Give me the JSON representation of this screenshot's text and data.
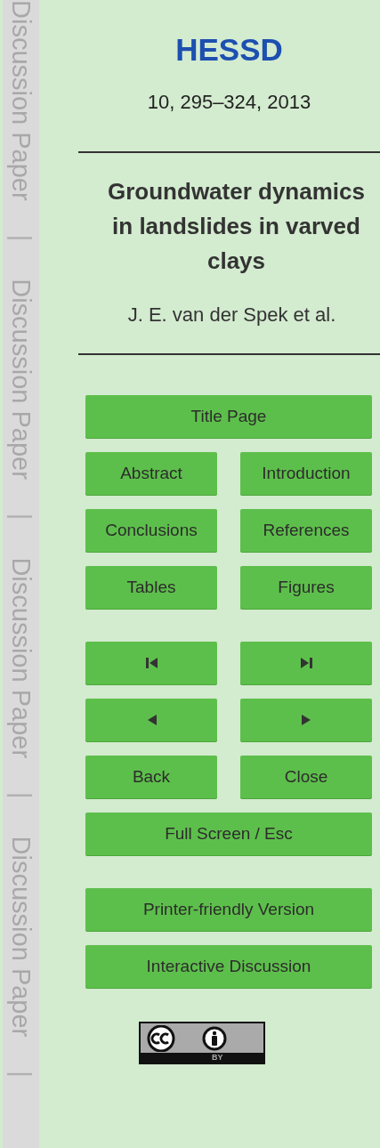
{
  "margin_strip": [
    {
      "kind": "label",
      "text": "Discussion Paper"
    },
    {
      "kind": "separator",
      "text": "|"
    },
    {
      "kind": "label",
      "text": "Discussion Paper"
    },
    {
      "kind": "separator",
      "text": "|"
    },
    {
      "kind": "label",
      "text": "Discussion Paper"
    },
    {
      "kind": "separator",
      "text": "|"
    },
    {
      "kind": "label",
      "text": "Discussion Paper"
    },
    {
      "kind": "separator",
      "text": "|"
    }
  ],
  "journal": "HESSD",
  "citation": "10, 295–324, 2013",
  "title": "Groundwater dynamics in landslides in varved clays",
  "authors": "J. E. van der Spek et al.",
  "button_groups": [
    [
      [
        {
          "kind": "text",
          "label": "Title Page"
        }
      ],
      [
        {
          "kind": "text",
          "label": "Abstract"
        },
        {
          "kind": "text",
          "label": "Introduction"
        }
      ],
      [
        {
          "kind": "text",
          "label": "Conclusions"
        },
        {
          "kind": "text",
          "label": "References"
        }
      ],
      [
        {
          "kind": "text",
          "label": "Tables"
        },
        {
          "kind": "text",
          "label": "Figures"
        }
      ]
    ],
    [
      [
        {
          "kind": "first"
        },
        {
          "kind": "last"
        }
      ],
      [
        {
          "kind": "prev"
        },
        {
          "kind": "next"
        }
      ],
      [
        {
          "kind": "text",
          "label": "Back"
        },
        {
          "kind": "text",
          "label": "Close"
        }
      ],
      [
        {
          "kind": "text",
          "label": "Full Screen / Esc"
        }
      ]
    ],
    [
      [
        {
          "kind": "text",
          "label": "Printer-friendly Version"
        }
      ],
      [
        {
          "kind": "text",
          "label": "Interactive Discussion"
        }
      ]
    ]
  ],
  "license_badge": {
    "text": "BY"
  }
}
